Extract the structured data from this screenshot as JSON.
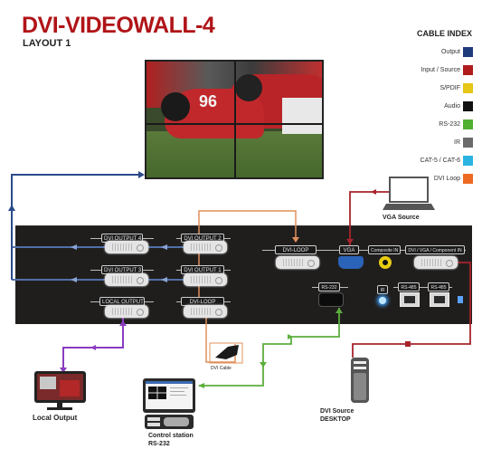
{
  "header": {
    "title": "DVI-VIDEOWALL-4",
    "subtitle": "LAYOUT 1"
  },
  "legend": {
    "title": "CABLE INDEX",
    "items": [
      {
        "label": "Output",
        "color": "#1f3a7a"
      },
      {
        "label": "Input / Source",
        "color": "#b01c1c"
      },
      {
        "label": "S/PDIF",
        "color": "#e6c617"
      },
      {
        "label": "Audio",
        "color": "#111111"
      },
      {
        "label": "RS-232",
        "color": "#4fb030"
      },
      {
        "label": "IR",
        "color": "#6a6a6a"
      },
      {
        "label": "CAT-5 / CAT-6",
        "color": "#2ab3e0"
      },
      {
        "label": "DVI Loop",
        "color": "#ee6a22"
      }
    ]
  },
  "video_wall": {
    "jersey_number": "96",
    "panels": 4
  },
  "panel": {
    "left_ports": [
      {
        "label": "DVI OUTPUT 4",
        "type": "dvi"
      },
      {
        "label": "DVI OUTPUT 2",
        "type": "dvi"
      },
      {
        "label": "DVI OUTPUT 3",
        "type": "dvi"
      },
      {
        "label": "DVI OUTPUT 1",
        "type": "dvi"
      },
      {
        "label": "LOCAL OUTPUT",
        "type": "dvi"
      },
      {
        "label": "DVI-LOOP",
        "type": "dvi"
      }
    ],
    "right_ports": [
      {
        "label": "DVI-LOOP",
        "type": "dvi"
      },
      {
        "label": "VGA",
        "type": "vga"
      },
      {
        "label": "Composite IN",
        "type": "rca"
      },
      {
        "label": "DVI / VGA / Component IN",
        "type": "dvi"
      },
      {
        "label": "RS-232",
        "type": "rs232"
      },
      {
        "label": "IR",
        "type": "led"
      },
      {
        "label": "RS-485",
        "type": "rj45"
      },
      {
        "label": "RS-485",
        "type": "rj45"
      }
    ]
  },
  "devices": {
    "vga_source": "VGA Source",
    "local_output": "Local Output",
    "dvi_cable": "DVI Cable",
    "control_station_line1": "Control station",
    "control_station_line2": "RS-232",
    "dvi_source_line1": "DVI Source",
    "dvi_source_line2": "DESKTOP"
  },
  "colors": {
    "output": "#2b4a8a",
    "input": "#a8242c",
    "rs232": "#5cae3c",
    "dvi_loop": "#e0905c",
    "local": "#8a3cc0"
  }
}
